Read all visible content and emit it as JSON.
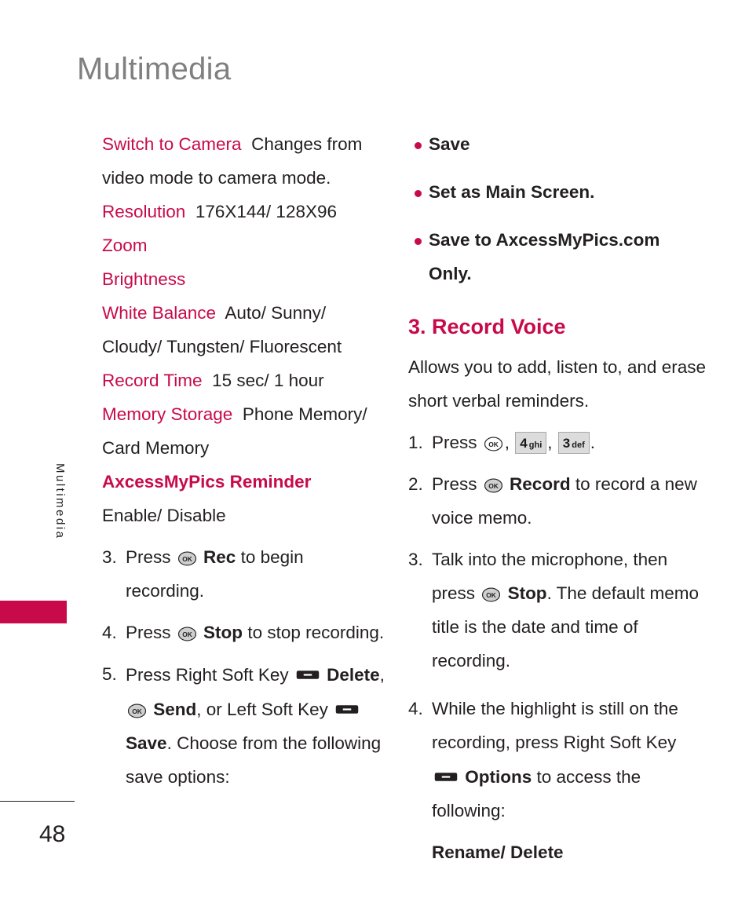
{
  "page": {
    "title": "Multimedia",
    "number": "48",
    "side_tab_label": "Multimedia",
    "accent_color": "#c80a4b",
    "title_color": "#808080",
    "body_color": "#231f20"
  },
  "icons": {
    "ok_key": "ok-key-icon",
    "ok_key_label": "OK",
    "soft_key": "soft-key-icon",
    "keypad_4": {
      "number": "4",
      "letters": "ghi"
    },
    "keypad_3": {
      "number": "3",
      "letters": "def"
    }
  },
  "left_column": {
    "settings": [
      {
        "term": "Switch to Camera",
        "desc": "Changes from video mode to camera mode."
      },
      {
        "term": "Resolution",
        "desc": "176X144/ 128X96"
      },
      {
        "term": "Zoom",
        "desc": ""
      },
      {
        "term": "Brightness",
        "desc": ""
      },
      {
        "term": "White Balance",
        "desc": "Auto/ Sunny/ Cloudy/ Tungsten/ Fluorescent"
      },
      {
        "term": "Record Time",
        "desc": "15 sec/ 1 hour"
      },
      {
        "term": "Memory Storage",
        "desc": "Phone Memory/ Card Memory"
      },
      {
        "term": "AxcessMyPics Reminder",
        "desc": "Enable/ Disable",
        "term_bold": true
      }
    ],
    "steps": [
      {
        "num": "3.",
        "pre": "Press",
        "key": "ok",
        "bold": "Rec",
        "post": "to begin recording."
      },
      {
        "num": "4.",
        "pre": "Press",
        "key": "ok",
        "bold": "Stop",
        "post": "to stop recording."
      },
      {
        "num": "5.",
        "pre": "Press Right Soft Key",
        "bold1": "Delete",
        "sep1": ",",
        "bold2": "Send",
        "mid": ", or Left Soft Key",
        "bold3": "Save",
        "post": ". Choose from the following save options:"
      }
    ]
  },
  "right_column": {
    "save_options": [
      "Save",
      "Set as Main Screen.",
      "Save to AxcessMyPics.com Only."
    ],
    "section": {
      "heading": "3. Record Voice",
      "intro": "Allows you to add, listen to, and erase short verbal reminders.",
      "steps": [
        {
          "num": "1.",
          "pre": "Press",
          "post": "."
        },
        {
          "num": "2.",
          "pre": "Press",
          "bold": "Record",
          "post": "to record a new voice memo."
        },
        {
          "num": "3.",
          "pre": "Talk into the microphone, then press",
          "bold": "Stop",
          "post": ". The default memo title is the date and time of recording."
        },
        {
          "num": "4.",
          "pre": "While the highlight is still on the recording, press Right Soft Key",
          "bold": "Options",
          "post": "to access the following:"
        }
      ],
      "footer_options": "Rename/ Delete"
    }
  }
}
